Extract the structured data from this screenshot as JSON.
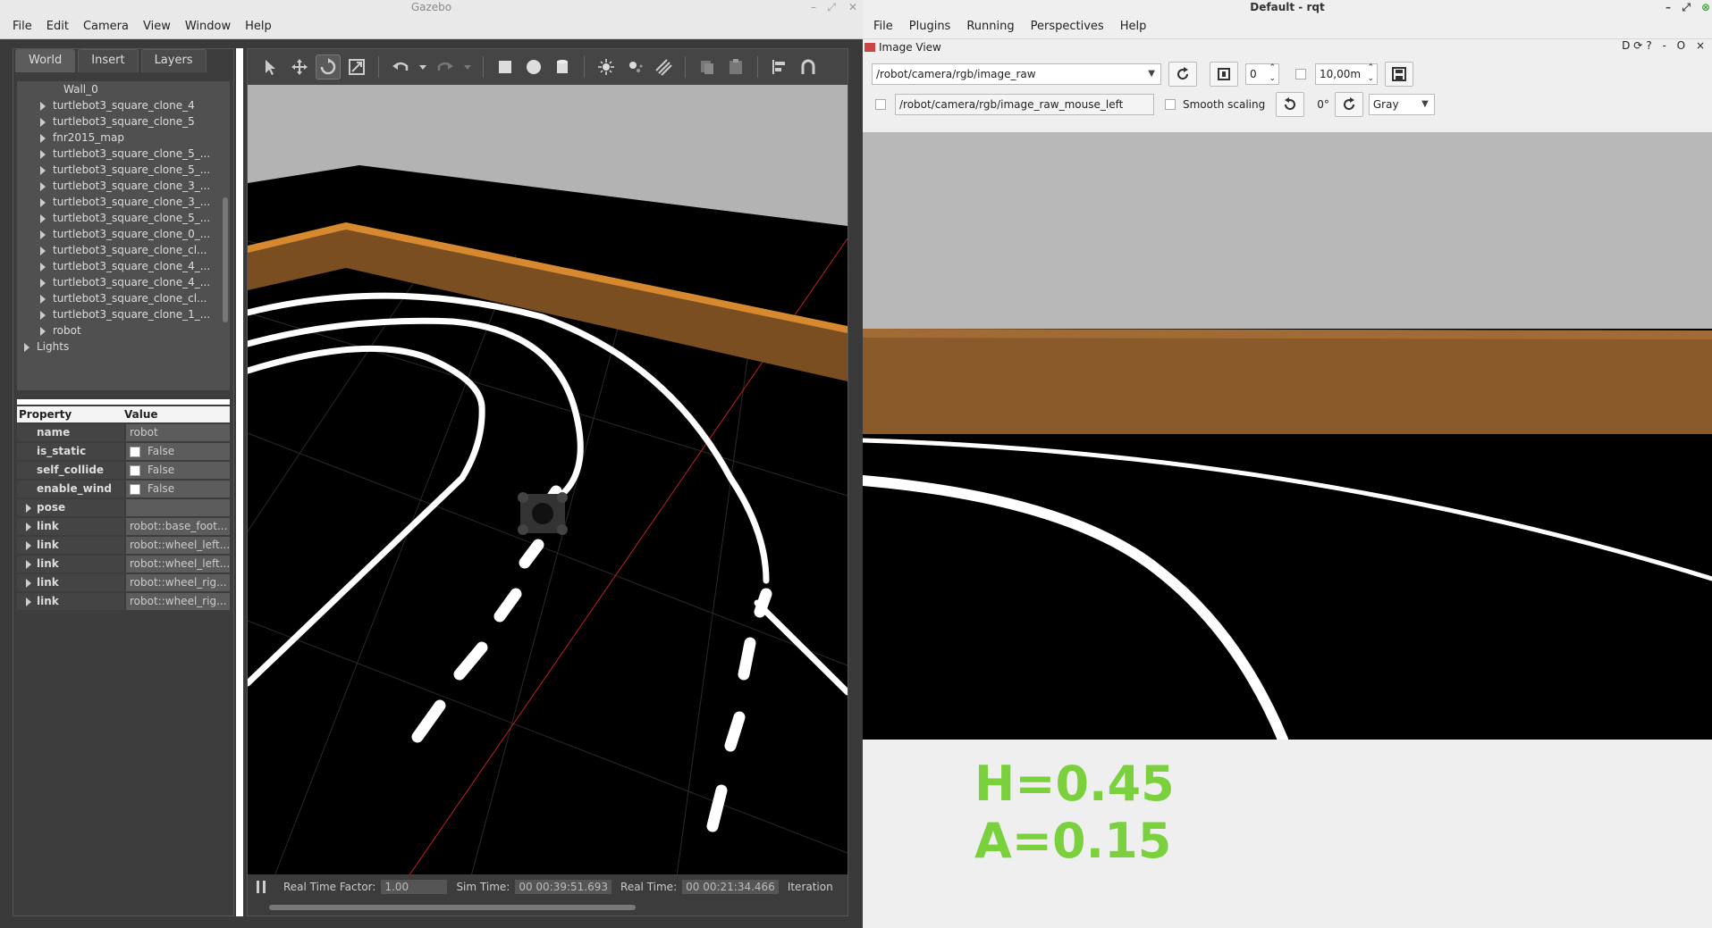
{
  "gazebo": {
    "title": "Gazebo",
    "menu": [
      "File",
      "Edit",
      "Camera",
      "View",
      "Window",
      "Help"
    ],
    "tabs": [
      "World",
      "Insert",
      "Layers"
    ],
    "tree_items": [
      {
        "label": "Wall_0",
        "expandable": false
      },
      {
        "label": "turtlebot3_square_clone_4",
        "expandable": true
      },
      {
        "label": "turtlebot3_square_clone_5",
        "expandable": true
      },
      {
        "label": "fnr2015_map",
        "expandable": true
      },
      {
        "label": "turtlebot3_square_clone_5_...",
        "expandable": true
      },
      {
        "label": "turtlebot3_square_clone_5_...",
        "expandable": true
      },
      {
        "label": "turtlebot3_square_clone_3_...",
        "expandable": true
      },
      {
        "label": "turtlebot3_square_clone_3_...",
        "expandable": true
      },
      {
        "label": "turtlebot3_square_clone_5_...",
        "expandable": true
      },
      {
        "label": "turtlebot3_square_clone_0_...",
        "expandable": true
      },
      {
        "label": "turtlebot3_square_clone_cl...",
        "expandable": true
      },
      {
        "label": "turtlebot3_square_clone_4_...",
        "expandable": true
      },
      {
        "label": "turtlebot3_square_clone_4_...",
        "expandable": true
      },
      {
        "label": "turtlebot3_square_clone_cl...",
        "expandable": true
      },
      {
        "label": "turtlebot3_square_clone_1_...",
        "expandable": true
      },
      {
        "label": "robot",
        "expandable": true
      },
      {
        "label": "Lights",
        "expandable": true
      }
    ],
    "props_header": {
      "property": "Property",
      "value": "Value"
    },
    "props": [
      {
        "key": "name",
        "value": "robot",
        "check": false,
        "expandable": false
      },
      {
        "key": "is_static",
        "value": "False",
        "check": true,
        "expandable": false
      },
      {
        "key": "self_collide",
        "value": "False",
        "check": true,
        "expandable": false
      },
      {
        "key": "enable_wind",
        "value": "False",
        "check": true,
        "expandable": false
      },
      {
        "key": "pose",
        "value": "",
        "check": false,
        "expandable": true
      },
      {
        "key": "link",
        "value": "robot::base_foot...",
        "check": false,
        "expandable": true
      },
      {
        "key": "link",
        "value": "robot::wheel_left...",
        "check": false,
        "expandable": true
      },
      {
        "key": "link",
        "value": "robot::wheel_left...",
        "check": false,
        "expandable": true
      },
      {
        "key": "link",
        "value": "robot::wheel_rig...",
        "check": false,
        "expandable": true
      },
      {
        "key": "link",
        "value": "robot::wheel_rig...",
        "check": false,
        "expandable": true
      }
    ],
    "status": {
      "rtf_label": "Real Time Factor:",
      "rtf_value": "1.00",
      "sim_label": "Sim Time:",
      "sim_value": "00 00:39:51.693",
      "real_label": "Real Time:",
      "real_value": "00 00:21:34.466",
      "iter_label": "Iteration"
    }
  },
  "rqt": {
    "title": "Default - rqt",
    "menu": [
      "File",
      "Plugins",
      "Running",
      "Perspectives",
      "Help"
    ],
    "dock_title": "Image View",
    "dock_buttons": "D⟳? - O ×",
    "topic": "/robot/camera/rgb/image_raw",
    "num_value": "0",
    "max_range": "10,00m",
    "mouse_topic": "/robot/camera/rgb/image_raw_mouse_left",
    "smooth_label": "Smooth scaling",
    "rotation": "0°",
    "color_scheme": "Gray",
    "overlay_h": "H=0.45",
    "overlay_a": "A=0.15"
  },
  "colors": {
    "overlay_text": "#7bd13d",
    "wall_wood": "#8a5a2b"
  }
}
